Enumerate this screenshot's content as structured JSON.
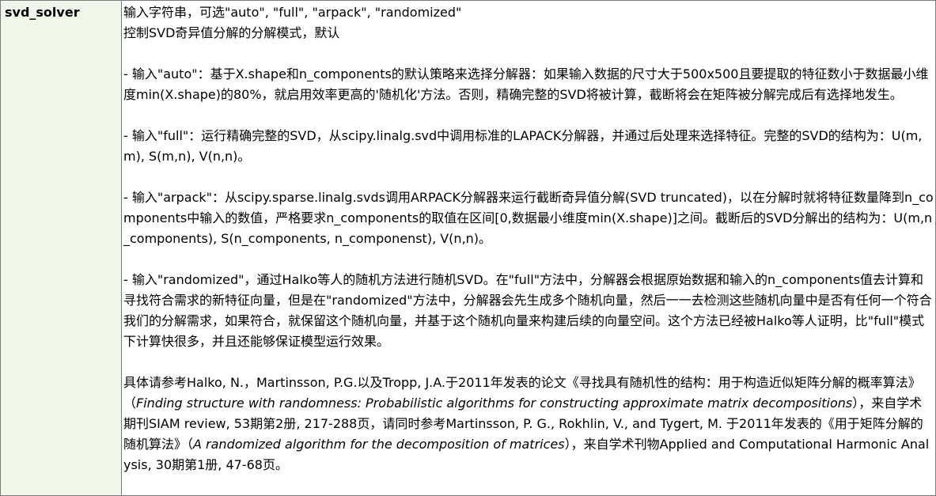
{
  "param": {
    "name": "svd_solver"
  },
  "description": {
    "intro_line1": "输入字符串，可选\"auto\", \"full\", \"arpack\", \"randomized\"",
    "intro_line2": "控制SVD奇异值分解的分解模式，默认",
    "auto_text": "- 输入\"auto\"：基于X.shape和n_components的默认策略来选择分解器：如果输入数据的尺寸大于500x500且要提取的特征数小于数据最小维度min(X.shape)的80%，就启用效率更高的'随机化'方法。否则，精确完整的SVD将被计算，截断将会在矩阵被分解完成后有选择地发生。",
    "full_text": "- 输入\"full\"：运行精确完整的SVD，从scipy.linalg.svd中调用标准的LAPACK分解器，并通过后处理来选择特征。完整的SVD的结构为：U(m,m), S(m,n), V(n,n)。",
    "arpack_text": "- 输入\"arpack\"：从scipy.sparse.linalg.svds调用ARPACK分解器来运行截断奇异值分解(SVD truncated)，以在分解时就将特征数量降到n_components中输入的数值，严格要求n_components的取值在区间[0,数据最小维度min(X.shape)]之间。截断后的SVD分解出的结构为：U(m,n_components), S(n_components, n_componenst), V(n,n)。",
    "randomized_text": "- 输入\"randomized\"，通过Halko等人的随机方法进行随机SVD。在\"full\"方法中，分解器会根据原始数据和输入的n_components值去计算和寻找符合需求的新特征向量，但是在\"randomized\"方法中，分解器会先生成多个随机向量，然后一一去检测这些随机向量中是否有任何一个符合我们的分解需求，如果符合，就保留这个随机向量，并基于这个随机向量来构建后续的向量空间。这个方法已经被Halko等人证明，比\"full\"模式下计算快很多，并且还能够保证模型运行效果。",
    "ref_part1": "具体请参考Halko, N.，Martinsson, P.G.以及Tropp, J.A.于2011年发表的论文《寻找具有随机性的结构：用于构造近似矩阵分解的概率算法》（",
    "ref_title1_en": "Finding structure with randomness: Probabilistic algorithms for constructing approximate matrix decompositions",
    "ref_part2": "），来自学术期刊SIAM review, 53期第2册, 217-288页，请同时参考Martinsson, P. G., Rokhlin, V., and Tygert, M. 于2011年发表的《用于矩阵分解的随机算法》（",
    "ref_title2_en": "A randomized algorithm for the decomposition of matrices",
    "ref_part3": "），来自学术刊物Applied and Computational Harmonic Analysis, 30期第1册, 47-68页。"
  }
}
